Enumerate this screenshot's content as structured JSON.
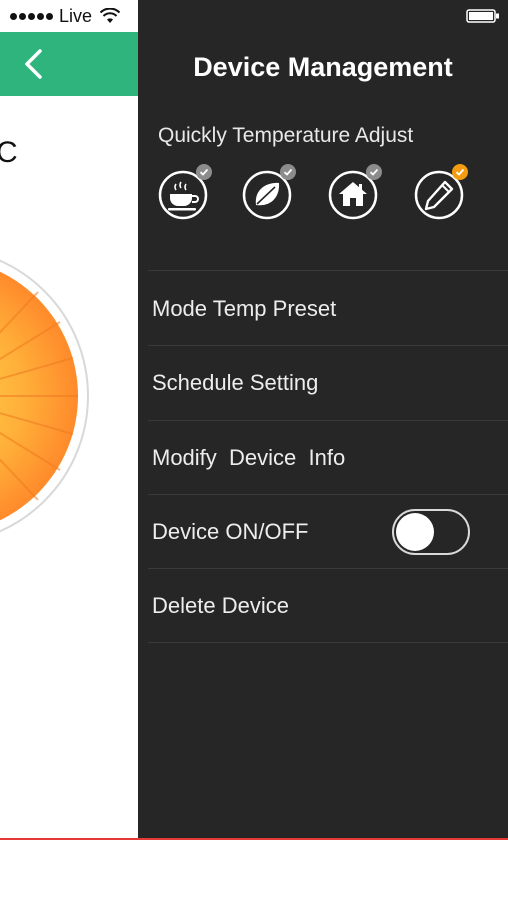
{
  "status_bar": {
    "carrier": "Live",
    "wifi_icon": "wifi-icon",
    "battery_icon": "battery-icon"
  },
  "left_screen": {
    "header_color": "#2fb47d",
    "back_icon": "chevron-left-icon",
    "unit_label": "C"
  },
  "drawer": {
    "title": "Device Management",
    "quick_adjust": {
      "label": "Quickly Temperature Adjust",
      "icons": [
        {
          "name": "coffee-cup-icon",
          "badge_color": "#8c8c8c"
        },
        {
          "name": "leaf-icon",
          "badge_color": "#8c8c8c"
        },
        {
          "name": "house-icon",
          "badge_color": "#8c8c8c"
        },
        {
          "name": "pencil-icon",
          "badge_color": "#f39c12"
        }
      ]
    },
    "menu": {
      "mode_temp_preset": "Mode Temp Preset",
      "schedule_setting": "Schedule Setting",
      "modify_device_info": "Modify  Device  Info",
      "device_on_off": "Device ON/OFF",
      "delete_device": "Delete Device"
    },
    "device_power_on": false
  },
  "colors": {
    "drawer_bg": "#262626",
    "accent_green": "#2fb47d",
    "accent_orange": "#f39c12",
    "bottom_accent": "#e53935"
  }
}
